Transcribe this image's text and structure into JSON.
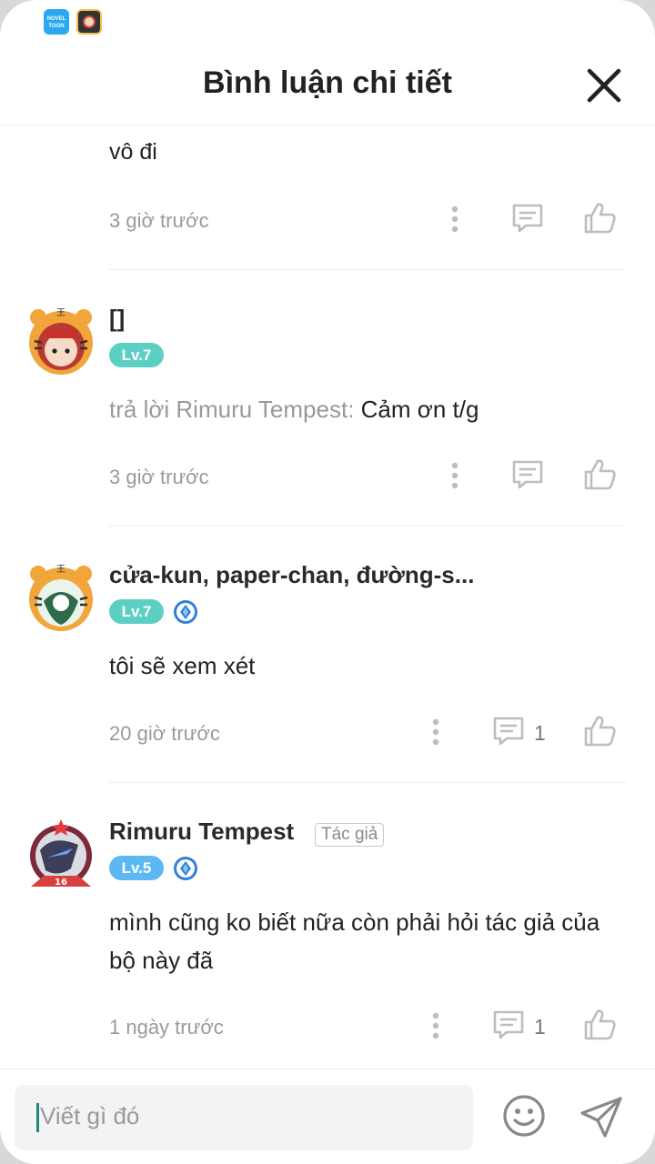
{
  "statusbar": {
    "novel_icon_text": "NOVEL TOON"
  },
  "header": {
    "title": "Bình luận chi tiết"
  },
  "partial_comment": {
    "text": "vô đi",
    "time": "3 giờ trước"
  },
  "comments": [
    {
      "name": "[]",
      "level": "Lv.7",
      "reply_prefix": "trả lời Rimuru Tempest:",
      "text": "Cảm ơn t/g",
      "time": "3 giờ trước",
      "reply_count": ""
    },
    {
      "name": "cửa-kun, paper-chan, đường-s...",
      "level": "Lv.7",
      "text": "tôi sẽ xem xét",
      "time": "20 giờ trước",
      "reply_count": "1"
    },
    {
      "name": "Rimuru Tempest",
      "author_tag": "Tác giả",
      "level": "Lv.5",
      "text": "mình cũng ko biết nữa còn phải hỏi tác giả của bộ này đã",
      "time": "1 ngày trước",
      "reply_count": "1"
    }
  ],
  "composer": {
    "placeholder": "Viết gì đó"
  },
  "colors": {
    "level_teal": "#5ccfc4",
    "level_blue": "#5bb8f2",
    "muted": "#9a9a9a",
    "icon": "#bdbdbd"
  }
}
